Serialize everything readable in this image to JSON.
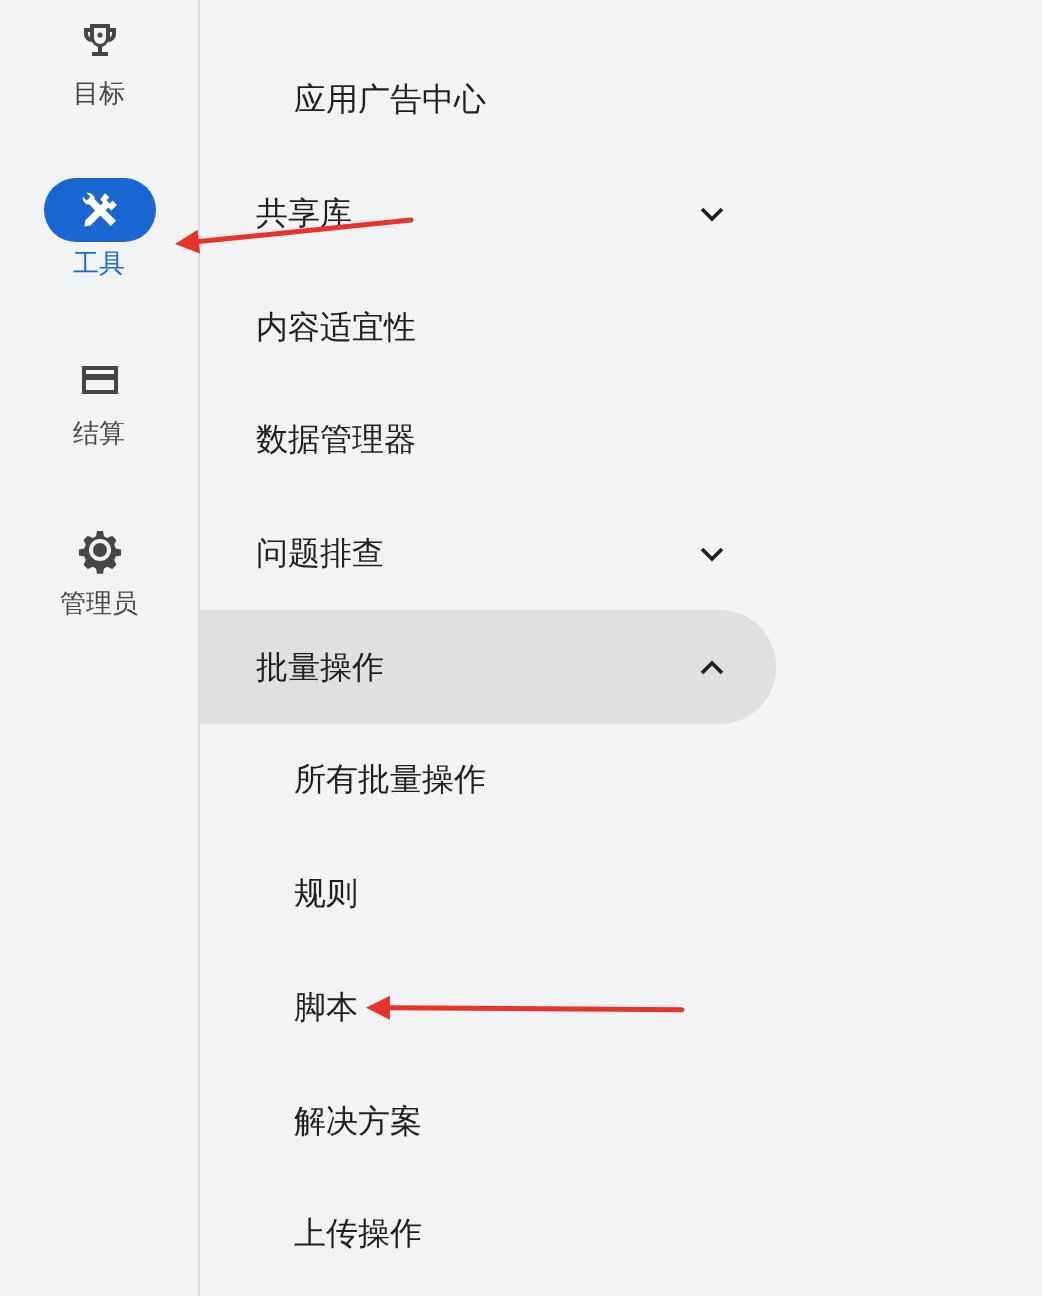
{
  "nav_rail": [
    {
      "label": "目标",
      "selected": false,
      "annotated": false
    },
    {
      "label": "工具",
      "selected": true,
      "annotated": true
    },
    {
      "label": "结算",
      "selected": false,
      "annotated": false
    },
    {
      "label": "管理员",
      "selected": false,
      "annotated": false
    }
  ],
  "menu": [
    {
      "children": [
        {
          "label": "应用广告中心",
          "selected": false,
          "annotated": false
        }
      ]
    },
    {
      "label": "共享库",
      "expanded": false,
      "selected": false
    },
    {
      "label": "内容适宜性",
      "selected": false
    },
    {
      "label": "数据管理器",
      "selected": false
    },
    {
      "label": "问题排查",
      "expanded": false,
      "selected": false
    },
    {
      "label": "批量操作",
      "expanded": true,
      "selected": true,
      "children": [
        {
          "label": "所有批量操作",
          "selected": false,
          "annotated": false
        },
        {
          "label": "规则",
          "selected": false,
          "annotated": false
        },
        {
          "label": "脚本",
          "selected": false,
          "annotated": true
        },
        {
          "label": "解决方案",
          "selected": false,
          "annotated": false
        },
        {
          "label": "上传操作",
          "selected": false,
          "annotated": false
        }
      ]
    }
  ]
}
